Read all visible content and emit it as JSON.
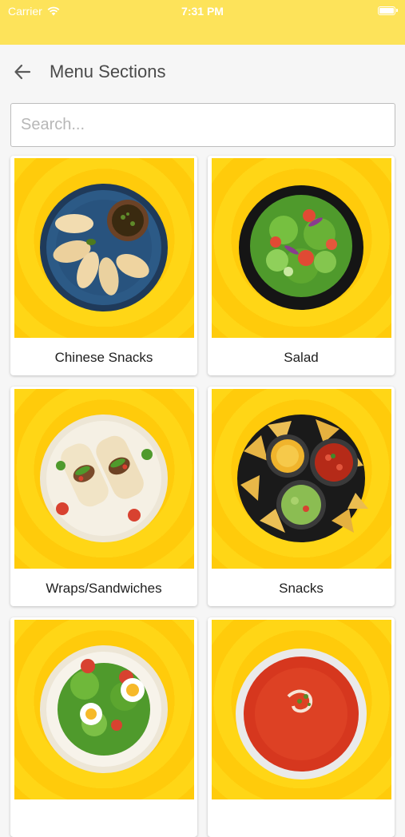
{
  "status_bar": {
    "carrier": "Carrier",
    "time": "7:31 PM"
  },
  "header": {
    "title": "Menu Sections"
  },
  "search": {
    "placeholder": "Search..."
  },
  "sections": [
    {
      "label": "Chinese Snacks",
      "image": "dumplings-plate"
    },
    {
      "label": "Salad",
      "image": "green-salad-bowl"
    },
    {
      "label": "Wraps/Sandwiches",
      "image": "wraps-plate"
    },
    {
      "label": "Snacks",
      "image": "nachos-dips-plate"
    },
    {
      "label": "",
      "image": "egg-salad-plate"
    },
    {
      "label": "",
      "image": "tomato-soup-bowl"
    }
  ],
  "colors": {
    "status_bar": "#fde35a",
    "card_background": "#ffcb0b",
    "page_background": "#f6f6f6"
  }
}
